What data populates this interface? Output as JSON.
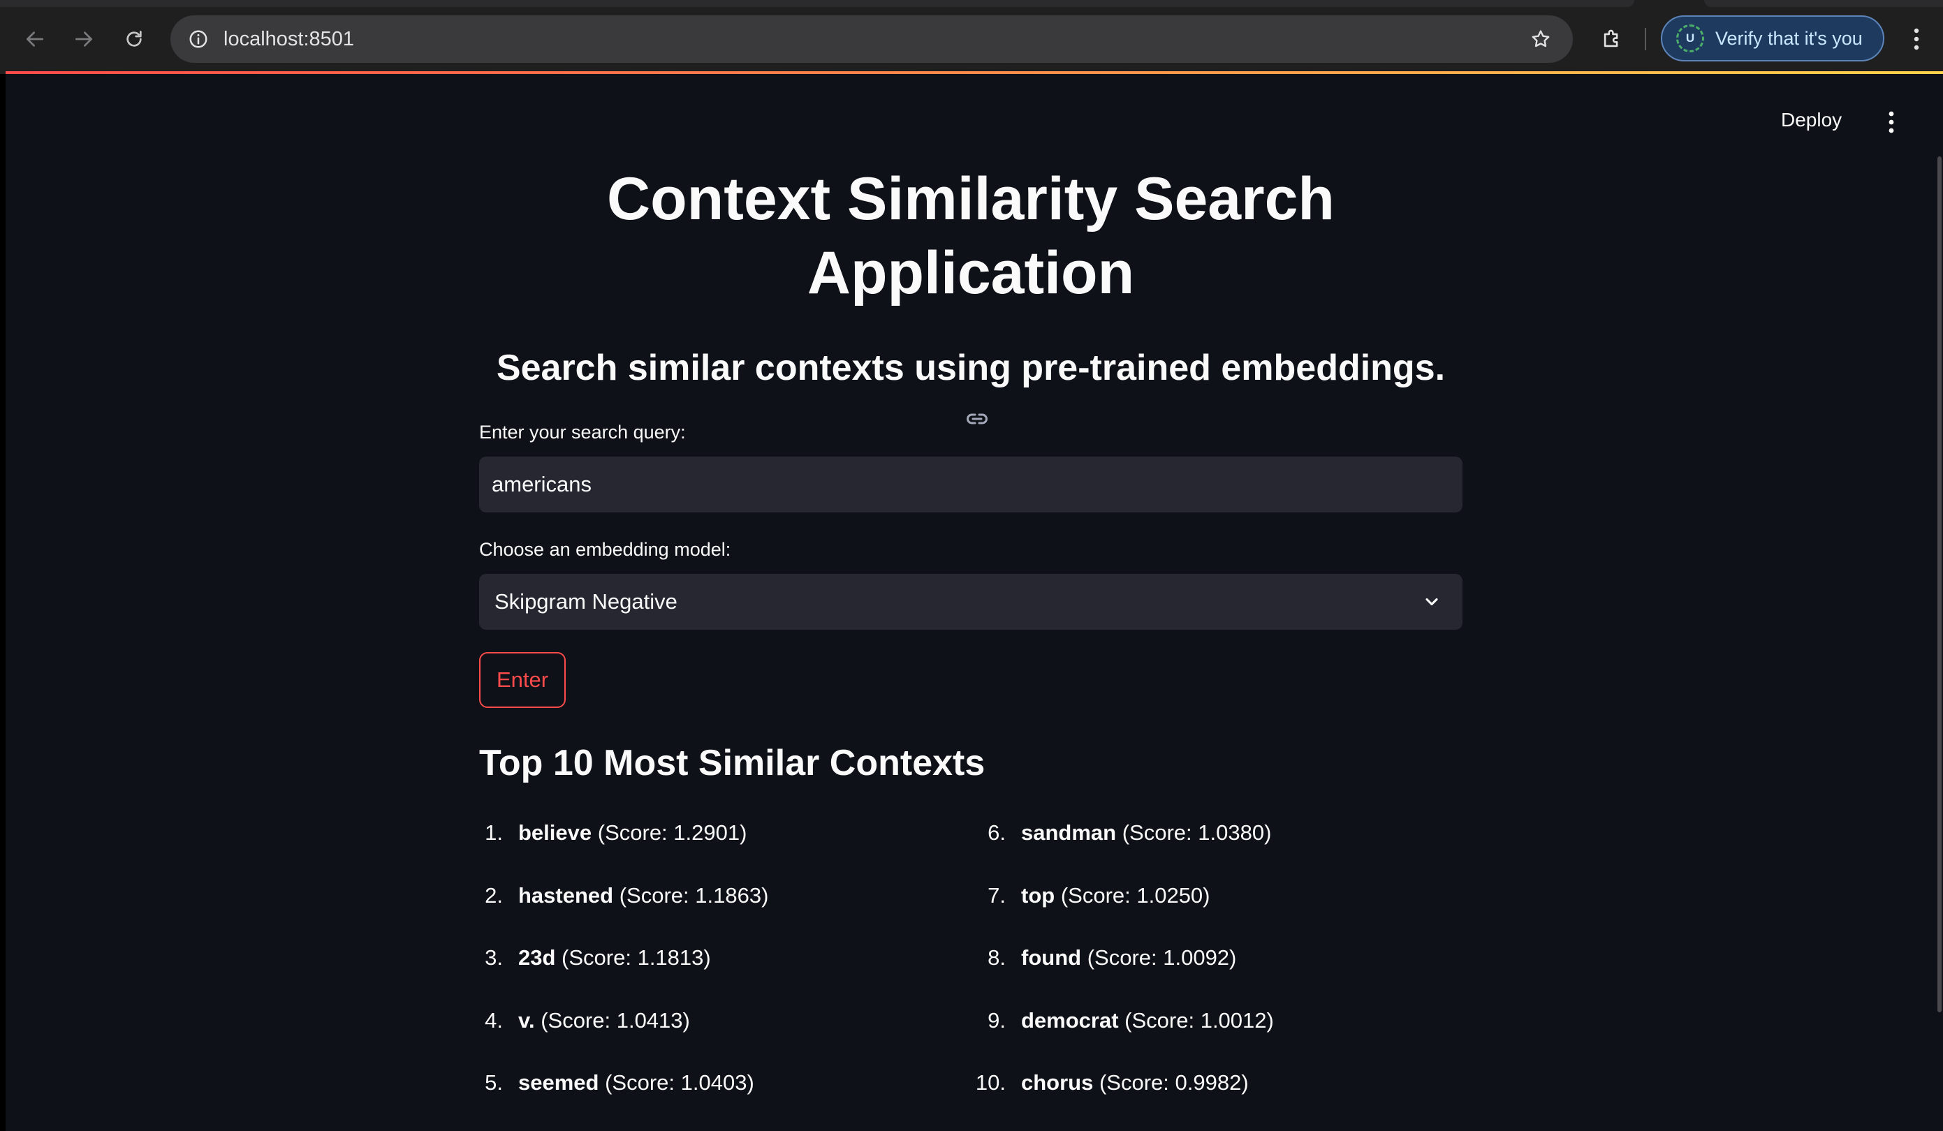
{
  "browser": {
    "url": "localhost:8501",
    "verify_label": "Verify that it's you",
    "profile_initial": "U"
  },
  "app": {
    "deploy_label": "Deploy",
    "title_line1": "Context Similarity Search",
    "title_line2": "Application",
    "subtitle": "Search similar contexts using pre-trained embeddings.",
    "query_label": "Enter your search query:",
    "query_value": "americans",
    "model_label": "Choose an embedding model:",
    "model_value": "Skipgram Negative",
    "enter_label": "Enter",
    "results_heading": "Top 10 Most Similar Contexts"
  },
  "results": [
    {
      "num": "1.",
      "word": "believe",
      "score": "(Score: 1.2901)"
    },
    {
      "num": "2.",
      "word": "hastened",
      "score": "(Score: 1.1863)"
    },
    {
      "num": "3.",
      "word": "23d",
      "score": "(Score: 1.1813)"
    },
    {
      "num": "4.",
      "word": "v.",
      "score": "(Score: 1.0413)"
    },
    {
      "num": "5.",
      "word": "seemed",
      "score": "(Score: 1.0403)"
    },
    {
      "num": "6.",
      "word": "sandman",
      "score": "(Score: 1.0380)"
    },
    {
      "num": "7.",
      "word": "top",
      "score": "(Score: 1.0250)"
    },
    {
      "num": "8.",
      "word": "found",
      "score": "(Score: 1.0092)"
    },
    {
      "num": "9.",
      "word": "democrat",
      "score": "(Score: 1.0012)"
    },
    {
      "num": "10.",
      "word": "chorus",
      "score": "(Score: 0.9982)"
    }
  ],
  "colors": {
    "background": "#0e1117",
    "input_bg": "#262730",
    "accent": "#ff4b4b",
    "text": "#fafafa"
  }
}
